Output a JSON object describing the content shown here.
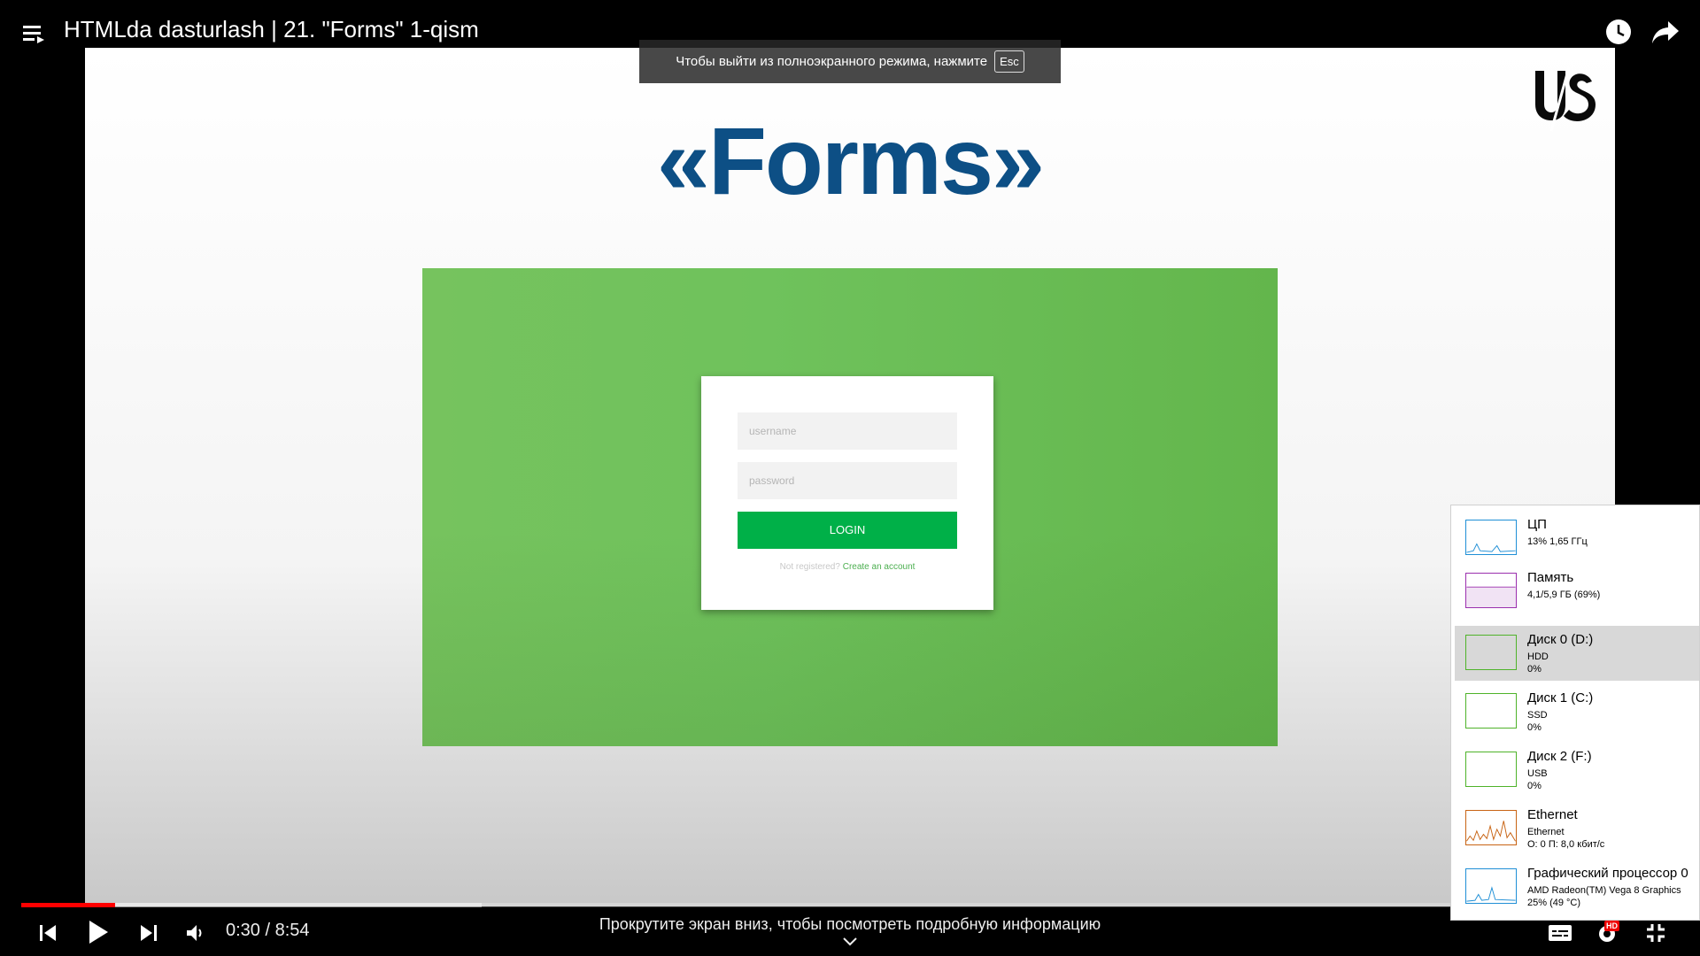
{
  "header": {
    "title": "HTMLda dasturlash | 21. \"Forms\" 1-qism",
    "icons": [
      "playlist-icon",
      "watch-later-icon",
      "share-icon"
    ]
  },
  "fullscreen_banner": {
    "text": "Чтобы выйти из полноэкранного режима, нажмите",
    "key": "Esc"
  },
  "slide": {
    "title": "«Forms»",
    "logo": "U/S",
    "form": {
      "username_placeholder": "username",
      "password_placeholder": "password",
      "login_label": "LOGIN",
      "not_registered": "Not registered?",
      "create_account": "Create an account"
    },
    "colors": {
      "title": "#0d4f85",
      "panel": "#6fc25c",
      "button": "#00b048"
    }
  },
  "player": {
    "time": "0:30 / 8:54",
    "progress_played_fraction": 0.065,
    "progress_loaded_fraction": 0.32,
    "scroll_hint": "Прокрутите экран вниз, чтобы посмотреть подробную информацию",
    "quality_badge": "HD",
    "icons": [
      "previous-icon",
      "play-icon",
      "next-icon",
      "volume-icon",
      "subtitles-icon",
      "settings-icon",
      "exit-fullscreen-icon"
    ]
  },
  "task_manager": {
    "items": [
      {
        "name": "ЦП",
        "line1": "13%  1,65 ГГц",
        "line2": "",
        "color": "#1f8fd6",
        "selected": false
      },
      {
        "name": "Память",
        "line1": "4,1/5,9 ГБ (69%)",
        "line2": "",
        "color": "#9b2fae",
        "selected": false
      },
      {
        "name": "Диск 0 (D:)",
        "line1": "HDD",
        "line2": "0%",
        "color": "#4fb32a",
        "selected": true
      },
      {
        "name": "Диск 1 (C:)",
        "line1": "SSD",
        "line2": "0%",
        "color": "#4fb32a",
        "selected": false
      },
      {
        "name": "Диск 2 (F:)",
        "line1": "USB",
        "line2": "0%",
        "color": "#4fb32a",
        "selected": false
      },
      {
        "name": "Ethernet",
        "line1": "Ethernet",
        "line2": "О: 0 П: 8,0 кбит/с",
        "color": "#c86414",
        "selected": false
      },
      {
        "name": "Графический процессор 0",
        "line1": "AMD Radeon(TM) Vega 8 Graphics",
        "line2": "25% (49 °C)",
        "color": "#1f8fd6",
        "selected": false
      }
    ]
  }
}
